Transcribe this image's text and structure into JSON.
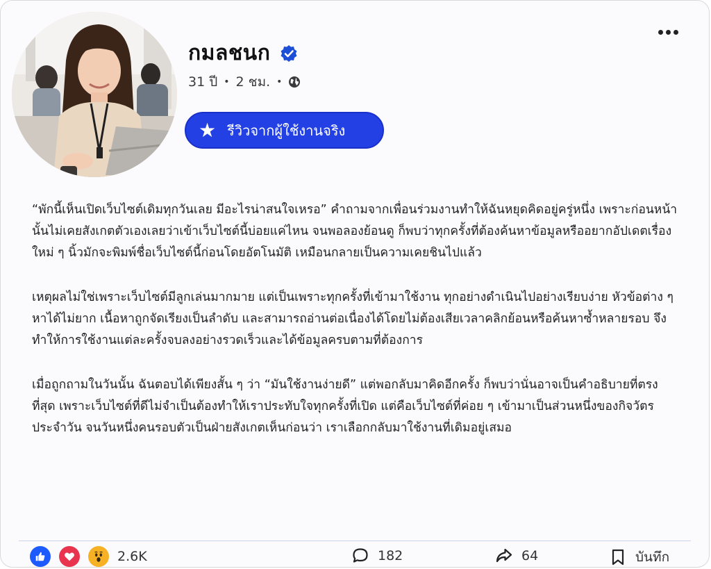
{
  "post": {
    "author_name": "กมลชนก",
    "age": "31 ปี",
    "time": "2 ชม.",
    "badge_label": "รีวิวจากผู้ใช้งานจริง",
    "paragraphs": [
      "“พักนี้เห็นเปิดเว็บไซต์เดิมทุกวันเลย มีอะไรน่าสนใจเหรอ” คำถามจากเพื่อนร่วมงานทำให้ฉันหยุดคิดอยู่ครู่หนึ่ง เพราะก่อนหน้านั้นไม่เคยสังเกตตัวเองเลยว่าเข้าเว็บไซต์นี้บ่อยแค่ไหน จนพอลองย้อนดู ก็พบว่าทุกครั้งที่ต้องค้นหาข้อมูลหรืออยากอัปเดตเรื่องใหม่ ๆ นิ้วมักจะพิมพ์ชื่อเว็บไซต์นี้ก่อนโดยอัตโนมัติ เหมือนกลายเป็นความเคยชินไปแล้ว",
      "เหตุผลไม่ใช่เพราะเว็บไซต์มีลูกเล่นมากมาย แต่เป็นเพราะทุกครั้งที่เข้ามาใช้งาน ทุกอย่างดำเนินไปอย่างเรียบง่าย หัวข้อต่าง ๆ หาได้ไม่ยาก เนื้อหาถูกจัดเรียงเป็นลำดับ และสามารถอ่านต่อเนื่องได้โดยไม่ต้องเสียเวลาคลิกย้อนหรือค้นหาซ้ำหลายรอบ จึงทำให้การใช้งานแต่ละครั้งจบลงอย่างรวดเร็วและได้ข้อมูลครบตามที่ต้องการ",
      "เมื่อถูกถามในวันนั้น ฉันตอบได้เพียงสั้น ๆ ว่า “มันใช้งานง่ายดี” แต่พอกลับมาคิดอีกครั้ง ก็พบว่านั่นอาจเป็นคำอธิบายที่ตรงที่สุด เพราะเว็บไซต์ที่ดีไม่จำเป็นต้องทำให้เราประทับใจทุกครั้งที่เปิด แต่คือเว็บไซต์ที่ค่อย ๆ เข้ามาเป็นส่วนหนึ่งของกิจวัตรประจำวัน จนวันหนึ่งคนรอบตัวเป็นฝ่ายสังเกตเห็นก่อนว่า เราเลือกกลับมาใช้งานที่เดิมอยู่เสมอ"
    ]
  },
  "footer": {
    "reaction_count": "2.6K",
    "comment_count": "182",
    "share_count": "64",
    "save_label": "บันทึก"
  },
  "icons": {
    "verified": "verified-check-icon",
    "globe": "globe-icon",
    "more": "more-options-icon",
    "star": "star-icon",
    "like": "like-icon",
    "love": "love-icon",
    "wow": "wow-icon",
    "comment": "comment-icon",
    "share": "share-icon",
    "save": "bookmark-icon"
  },
  "colors": {
    "badge_bg": "#2340e4",
    "verified": "#1d4ed8",
    "like": "#1d5bff",
    "love": "#e8344e",
    "wow": "#f7b125"
  }
}
